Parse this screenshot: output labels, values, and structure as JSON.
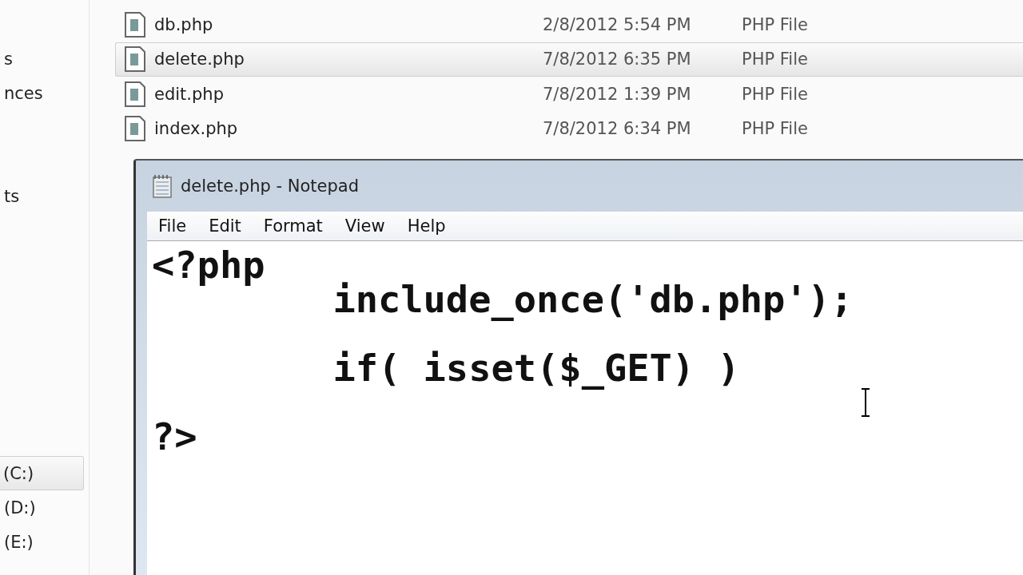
{
  "sidebar": {
    "groups": [
      {
        "items": [
          {
            "label": "s",
            "selected": false
          },
          {
            "label": "nces",
            "selected": false
          }
        ]
      },
      {
        "items": [
          {
            "label": "ts",
            "selected": false
          }
        ]
      },
      {
        "items": [
          {
            "label": "(C:)",
            "selected": true
          },
          {
            "label": "(D:)",
            "selected": false
          },
          {
            "label": "(E:)",
            "selected": false
          }
        ]
      }
    ]
  },
  "files": [
    {
      "name": "db.php",
      "date": "2/8/2012 5:54 PM",
      "type": "PHP File",
      "selected": false
    },
    {
      "name": "delete.php",
      "date": "7/8/2012 6:35 PM",
      "type": "PHP File",
      "selected": true
    },
    {
      "name": "edit.php",
      "date": "7/8/2012 1:39 PM",
      "type": "PHP File",
      "selected": false
    },
    {
      "name": "index.php",
      "date": "7/8/2012 6:34 PM",
      "type": "PHP File",
      "selected": false
    }
  ],
  "notepad": {
    "title": "delete.php - Notepad",
    "menu": [
      "File",
      "Edit",
      "Format",
      "View",
      "Help"
    ],
    "lines": [
      {
        "text": "<?php",
        "gap_before": false
      },
      {
        "text": "\tinclude_once('db.php');",
        "gap_before": false
      },
      {
        "text": "\tif( isset($_GET) )",
        "gap_before": true
      },
      {
        "text": "?>",
        "gap_before": true
      }
    ]
  }
}
